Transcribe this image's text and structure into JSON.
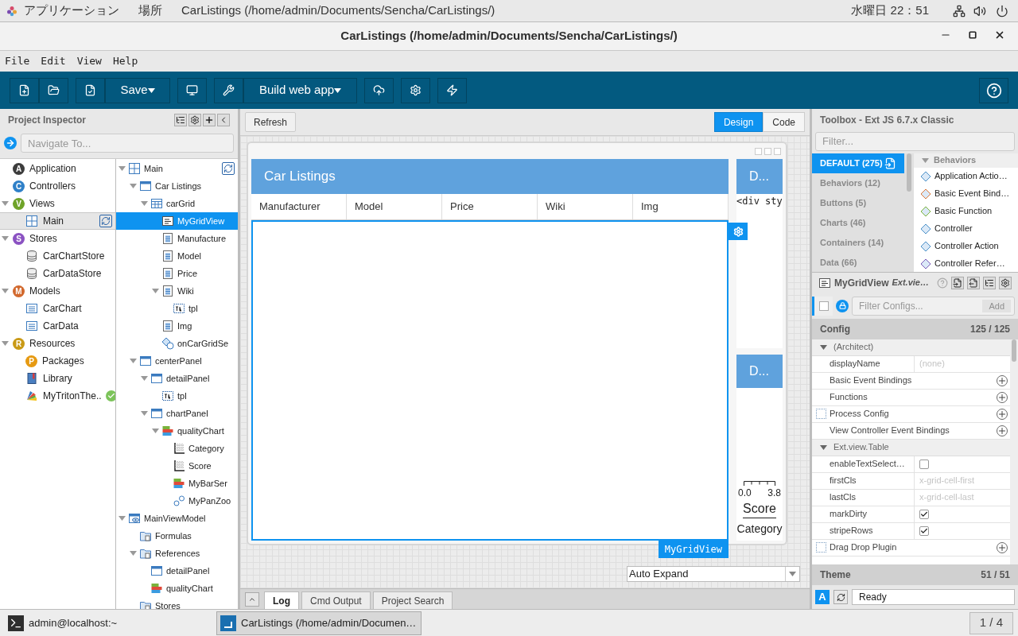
{
  "system_bar": {
    "menus": [
      "アプリケーション",
      "場所"
    ],
    "active_window": "CarListings (/home/admin/Documents/Sencha/CarListings/)",
    "clock": "水曜日 22：51"
  },
  "window": {
    "title": "CarListings (/home/admin/Documents/Sencha/CarListings/)"
  },
  "menu": [
    "File",
    "Edit",
    "View",
    "Help"
  ],
  "toolbar": {
    "save": "Save",
    "build": "Build web app"
  },
  "project_inspector": {
    "title": "Project Inspector",
    "navigate_placeholder": "Navigate To...",
    "nodes": [
      {
        "label": "Application",
        "kind": "badge",
        "badge": "A",
        "color": "#3d3d3d",
        "selected": false
      },
      {
        "label": "Controllers",
        "kind": "badge",
        "badge": "C",
        "color": "#2f80c8",
        "selected": false
      },
      {
        "label": "Views",
        "kind": "badge",
        "badge": "V",
        "color": "#6fa329",
        "selected": false,
        "expanded": true,
        "children": [
          {
            "label": "Main",
            "kind": "viewport",
            "selected": true,
            "linked": true
          }
        ]
      },
      {
        "label": "Stores",
        "kind": "badge",
        "badge": "S",
        "color": "#8b52c2",
        "selected": false,
        "expanded": true,
        "children": [
          {
            "label": "CarChartStore",
            "kind": "store",
            "selected": false
          },
          {
            "label": "CarDataStore",
            "kind": "store",
            "selected": false
          }
        ]
      },
      {
        "label": "Models",
        "kind": "badge",
        "badge": "M",
        "color": "#d2692e",
        "selected": false,
        "expanded": true,
        "children": [
          {
            "label": "CarChart",
            "kind": "model",
            "selected": false
          },
          {
            "label": "CarData",
            "kind": "model",
            "selected": false
          }
        ]
      },
      {
        "label": "Resources",
        "kind": "badge",
        "badge": "R",
        "color": "#c99a16",
        "selected": false,
        "expanded": true,
        "children": [
          {
            "label": "Packages",
            "kind": "badge",
            "badge": "P",
            "color": "#e69a12",
            "selected": false
          },
          {
            "label": "Library",
            "kind": "library",
            "selected": false
          },
          {
            "label": "MyTritonThe..",
            "kind": "theme",
            "selected": false,
            "valid": true
          }
        ]
      }
    ],
    "components": [
      {
        "label": "Main",
        "kind": "viewport",
        "selected": false,
        "linked": true,
        "expanded": true,
        "children": [
          {
            "label": "Car Listings",
            "kind": "panel",
            "selected": false,
            "expanded": true,
            "children": [
              {
                "label": "carGrid",
                "kind": "grid",
                "selected": false,
                "expanded": true,
                "children": [
                  {
                    "label": "MyGridView",
                    "kind": "gridview",
                    "selected": true
                  },
                  {
                    "label": "Manufacture",
                    "kind": "column",
                    "selected": false
                  },
                  {
                    "label": "Model",
                    "kind": "column",
                    "selected": false
                  },
                  {
                    "label": "Price",
                    "kind": "column",
                    "selected": false
                  },
                  {
                    "label": "Wiki",
                    "kind": "templatecolumn",
                    "selected": false,
                    "expanded": true,
                    "children": [
                      {
                        "label": "tpl",
                        "kind": "template",
                        "selected": false
                      }
                    ]
                  },
                  {
                    "label": "Img",
                    "kind": "column",
                    "selected": false
                  },
                  {
                    "label": "onCarGridSe",
                    "kind": "event",
                    "selected": false
                  }
                ]
              }
            ]
          },
          {
            "label": "centerPanel",
            "kind": "panel",
            "selected": false,
            "expanded": true,
            "children": [
              {
                "label": "detailPanel",
                "kind": "panel",
                "selected": false,
                "expanded": true,
                "children": [
                  {
                    "label": "tpl",
                    "kind": "template",
                    "selected": false
                  }
                ]
              },
              {
                "label": "chartPanel",
                "kind": "panel",
                "selected": false,
                "expanded": true,
                "children": [
                  {
                    "label": "qualityChart",
                    "kind": "chart",
                    "selected": false,
                    "expanded": true,
                    "children": [
                      {
                        "label": "Category",
                        "kind": "axis",
                        "selected": false
                      },
                      {
                        "label": "Score",
                        "kind": "axis",
                        "selected": false
                      },
                      {
                        "label": "MyBarSer",
                        "kind": "series",
                        "selected": false
                      },
                      {
                        "label": "MyPanZoo",
                        "kind": "interaction",
                        "selected": false
                      }
                    ]
                  }
                ]
              }
            ]
          }
        ]
      },
      {
        "label": "MainViewModel",
        "kind": "viewmodel",
        "selected": false,
        "expanded": true,
        "children": [
          {
            "label": "Formulas",
            "kind": "folder",
            "selected": false
          },
          {
            "label": "References",
            "kind": "folder",
            "selected": false,
            "expanded": true,
            "children": [
              {
                "label": "detailPanel",
                "kind": "panel",
                "selected": false
              },
              {
                "label": "qualityChart",
                "kind": "chart",
                "selected": false
              }
            ]
          },
          {
            "label": "Stores",
            "kind": "folder",
            "selected": false
          }
        ]
      }
    ]
  },
  "designer": {
    "refresh": "Refresh",
    "view_tabs": [
      {
        "label": "Design",
        "selected": true
      },
      {
        "label": "Code",
        "selected": false
      }
    ],
    "grid_panel": {
      "title": "Car Listings",
      "columns": [
        "Manufacturer",
        "Model",
        "Price",
        "Wiki",
        "Img"
      ],
      "selection_label": "MyGridView"
    },
    "detail_panel": {
      "title": "D...",
      "content": "<div sty"
    },
    "chart_panel": {
      "title": "D...",
      "tick_labels": [
        "0.0",
        "3.8"
      ],
      "axis_titles": [
        "Score",
        "Category"
      ]
    },
    "layout_select": "Auto Expand",
    "bottom_tabs": [
      {
        "label": "Log",
        "selected": true
      },
      {
        "label": "Cmd Output",
        "selected": false
      },
      {
        "label": "Project Search",
        "selected": false
      }
    ]
  },
  "toolbox": {
    "title": "Toolbox - Ext JS 6.7.x Classic",
    "filter_placeholder": "Filter...",
    "categories": [
      {
        "label": "DEFAULT (275)",
        "selected": true
      },
      {
        "label": "Behaviors (12)",
        "selected": false
      },
      {
        "label": "Buttons (5)",
        "selected": false
      },
      {
        "label": "Charts (46)",
        "selected": false
      },
      {
        "label": "Containers (14)",
        "selected": false
      },
      {
        "label": "Data (66)",
        "selected": false
      }
    ],
    "group": "Behaviors",
    "items": [
      {
        "label": "Application Actio…",
        "color": "#4a90c8"
      },
      {
        "label": "Basic Event Bind…",
        "color": "#d9773a"
      },
      {
        "label": "Basic Function",
        "color": "#79b23b"
      },
      {
        "label": "Controller",
        "color": "#4a90c8"
      },
      {
        "label": "Controller Action",
        "color": "#4a90c8"
      },
      {
        "label": "Controller Refer…",
        "color": "#7a5ab8"
      }
    ]
  },
  "config": {
    "component": "MyGridView",
    "class": "Ext.vie…",
    "filter_placeholder": "Filter Configs...",
    "add": {
      "label": "Add",
      "disabled": true
    },
    "section": "Config",
    "count": "125 / 125",
    "rows": [
      {
        "kind": "group",
        "name": "(Architect)"
      },
      {
        "kind": "value",
        "name": "displayName",
        "value": "(none)"
      },
      {
        "kind": "add",
        "name": "Basic Event Bindings"
      },
      {
        "kind": "add",
        "name": "Functions"
      },
      {
        "kind": "plugin",
        "name": "Process Config"
      },
      {
        "kind": "add",
        "name": "View Controller Event Bindings"
      },
      {
        "kind": "group",
        "name": "Ext.view.Table"
      },
      {
        "kind": "check",
        "name": "enableTextSelect…",
        "checked": false
      },
      {
        "kind": "value",
        "name": "firstCls",
        "value": "x-grid-cell-first"
      },
      {
        "kind": "value",
        "name": "lastCls",
        "value": "x-grid-cell-last"
      },
      {
        "kind": "check",
        "name": "markDirty",
        "checked": true
      },
      {
        "kind": "check",
        "name": "stripeRows",
        "checked": true
      },
      {
        "kind": "plugin",
        "name": "Drag Drop Plugin"
      }
    ],
    "theme": "Theme",
    "theme_count": "51 / 51",
    "theme_button": "A",
    "status": "Ready",
    "select_all": {
      "checked": false
    }
  },
  "taskbar": {
    "items": [
      {
        "label": "admin@localhost:~",
        "kind": "terminal",
        "selected": false
      },
      {
        "label": "CarListings (/home/admin/Documen…",
        "kind": "app",
        "selected": true
      }
    ],
    "workspace": "1 / 4"
  }
}
